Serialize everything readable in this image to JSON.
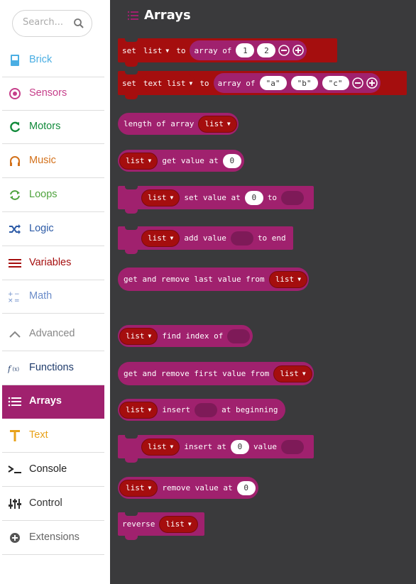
{
  "search": {
    "placeholder": "Search..."
  },
  "categories": [
    {
      "label": "Brick",
      "color": "#4aaee3",
      "icon": "brick-icon"
    },
    {
      "label": "Sensors",
      "color": "#c63e8a",
      "icon": "sensors-icon"
    },
    {
      "label": "Motors",
      "color": "#128a3b",
      "icon": "motors-icon"
    },
    {
      "label": "Music",
      "color": "#d3711b",
      "icon": "music-icon"
    },
    {
      "label": "Loops",
      "color": "#4fa33e",
      "icon": "loops-icon"
    },
    {
      "label": "Logic",
      "color": "#2c5aa6",
      "icon": "logic-icon"
    },
    {
      "label": "Variables",
      "color": "#a50e0e",
      "icon": "variables-icon"
    },
    {
      "label": "Math",
      "color": "#6b8cc9",
      "icon": "math-icon"
    },
    {
      "label": "Advanced",
      "color": "#888888",
      "icon": "chevron-up-icon"
    },
    {
      "label": "Functions",
      "color": "#1f3b6b",
      "icon": "functions-icon"
    },
    {
      "label": "Arrays",
      "color": "#ffffff",
      "icon": "arrays-icon"
    },
    {
      "label": "Text",
      "color": "#e8a21a",
      "icon": "text-icon"
    },
    {
      "label": "Console",
      "color": "#222222",
      "icon": "console-icon"
    },
    {
      "label": "Control",
      "color": "#333333",
      "icon": "control-icon"
    },
    {
      "label": "Extensions",
      "color": "#666666",
      "icon": "extensions-icon"
    }
  ],
  "selected_category": "Arrays",
  "workspace": {
    "title": "Arrays",
    "background": "#3a3a3c"
  },
  "colors": {
    "variable": "#a50e0e",
    "array": "#a0216e",
    "selected": "#a0216e"
  },
  "blocks": {
    "set_list": {
      "set": "set",
      "var": "list",
      "to": "to",
      "array_of": "array of",
      "v1": "1",
      "v2": "2"
    },
    "set_text_list": {
      "set": "set",
      "var": "text list",
      "to": "to",
      "array_of": "array of",
      "v1": "\"a\"",
      "v2": "\"b\"",
      "v3": "\"c\""
    },
    "length": {
      "label": "length of array",
      "var": "list"
    },
    "get_value": {
      "var": "list",
      "label": "get value at",
      "index": "0"
    },
    "set_value": {
      "var": "list",
      "label": "set value at",
      "index": "0",
      "to": "to"
    },
    "add_value": {
      "var": "list",
      "label": "add value",
      "end": "to end"
    },
    "remove_last": {
      "label": "get and remove last value from",
      "var": "list"
    },
    "find_index": {
      "var": "list",
      "label": "find index of"
    },
    "remove_first": {
      "label": "get and remove first value from",
      "var": "list"
    },
    "insert_begin": {
      "var": "list",
      "label": "insert",
      "end": "at beginning"
    },
    "insert_at": {
      "var": "list",
      "label": "insert at",
      "index": "0",
      "value": "value"
    },
    "remove_value": {
      "var": "list",
      "label": "remove value at",
      "index": "0"
    },
    "reverse": {
      "label": "reverse",
      "var": "list"
    }
  }
}
